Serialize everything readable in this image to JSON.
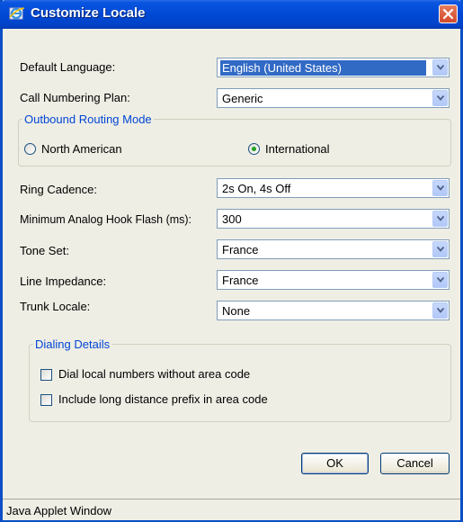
{
  "title": "Customize Locale",
  "fields": [
    {
      "label": "Default Language:",
      "value": "English (United States)"
    },
    {
      "label": "Call Numbering Plan:",
      "value": "Generic"
    }
  ],
  "routing": {
    "legend": "Outbound Routing Mode",
    "options": [
      {
        "label": "North American",
        "selected": false
      },
      {
        "label": "International",
        "selected": true
      }
    ]
  },
  "fields2": [
    {
      "label": "Ring Cadence:",
      "value": "2s On, 4s Off"
    },
    {
      "label": "Minimum Analog Hook Flash (ms):",
      "value": "300"
    },
    {
      "label": "Tone Set:",
      "value": "France"
    },
    {
      "label": "Line Impedance:",
      "value": "France"
    },
    {
      "label": "Trunk Locale:",
      "value": "None"
    }
  ],
  "dialing": {
    "legend": "Dialing Details",
    "options": [
      {
        "label": "Dial local numbers without area code",
        "checked": false
      },
      {
        "label": "Include long distance prefix in area code",
        "checked": false
      }
    ]
  },
  "buttons": {
    "ok": "OK",
    "cancel": "Cancel"
  },
  "status_bar": "Java Applet Window"
}
